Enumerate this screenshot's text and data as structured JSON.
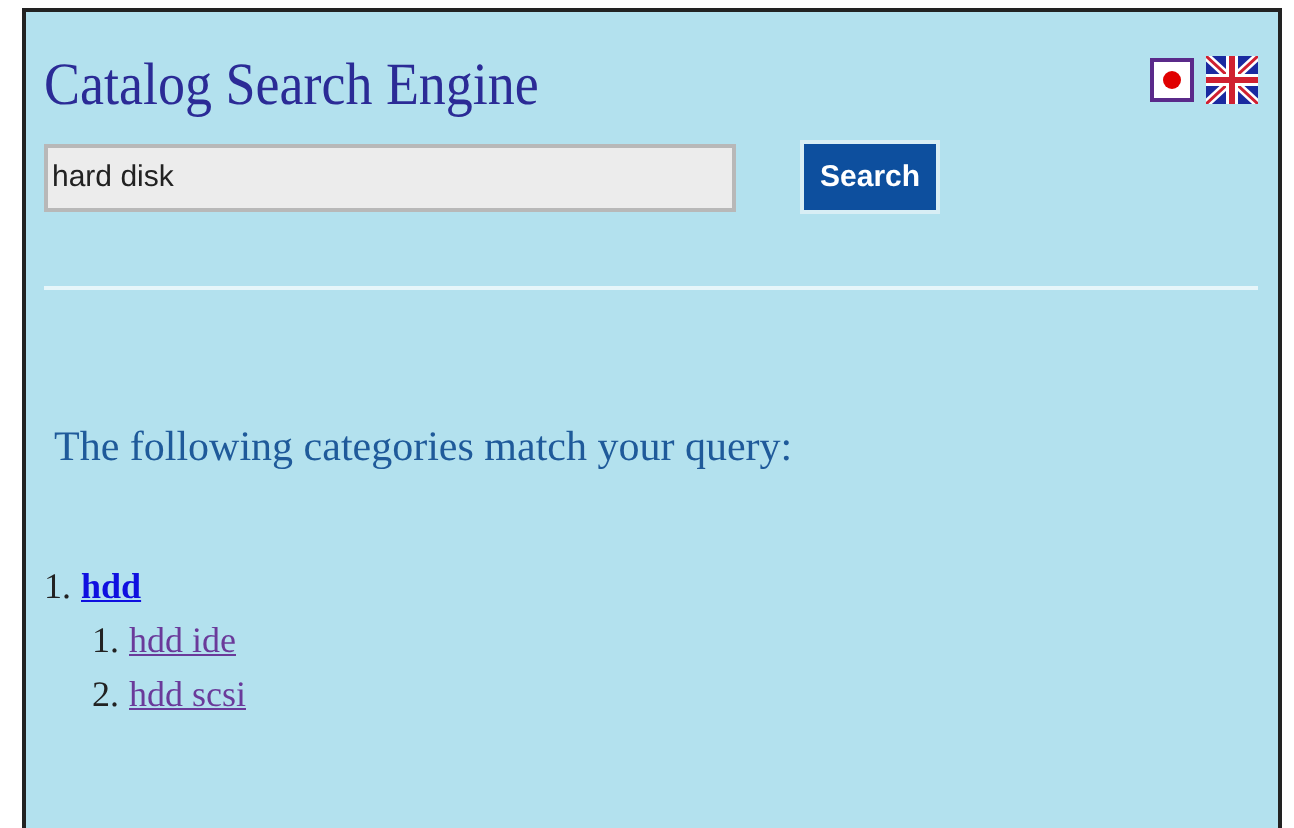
{
  "header": {
    "title": "Catalog Search Engine"
  },
  "languages": [
    {
      "kind": "japan"
    },
    {
      "kind": "uk"
    }
  ],
  "search": {
    "value": "hard disk",
    "button": "Search"
  },
  "results": {
    "heading": "The following categories match your query:",
    "items": [
      {
        "number": "1.",
        "label": "hdd",
        "visited": false,
        "children": [
          {
            "number": "1.",
            "label": "hdd ide",
            "visited": true
          },
          {
            "number": "2.",
            "label": "hdd scsi",
            "visited": true
          }
        ]
      }
    ]
  }
}
